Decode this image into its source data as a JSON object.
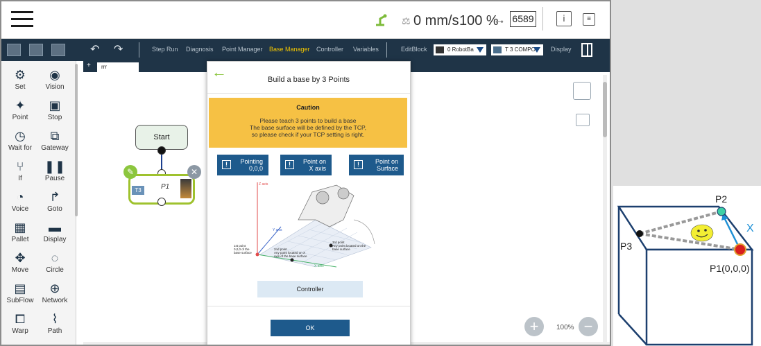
{
  "status": {
    "speed": "0 mm/s",
    "percent": "100 %",
    "counter": "6589",
    "info_icon": "info-icon",
    "menu_icon": "menu-icon"
  },
  "toolbar": {
    "items": [
      "Step Run",
      "Diagnosis",
      "Point Manager",
      "Base Manager",
      "Controller",
      "Variables",
      "EditBlock",
      "Display"
    ],
    "robot_drop": "0 RobotBa",
    "compo_drop": "T 3 COMPO"
  },
  "palette": [
    {
      "label": "Set",
      "icon": "set-icon"
    },
    {
      "label": "Vision",
      "icon": "vision-icon"
    },
    {
      "label": "Point",
      "icon": "point-icon"
    },
    {
      "label": "Stop",
      "icon": "stop-icon"
    },
    {
      "label": "Wait for",
      "icon": "wait-icon"
    },
    {
      "label": "Gateway",
      "icon": "gateway-icon"
    },
    {
      "label": "If",
      "icon": "if-icon"
    },
    {
      "label": "Pause",
      "icon": "pause-icon"
    },
    {
      "label": "Voice",
      "icon": "voice-icon"
    },
    {
      "label": "Goto",
      "icon": "goto-icon"
    },
    {
      "label": "Pallet",
      "icon": "pallet-icon"
    },
    {
      "label": "Display",
      "icon": "display-icon"
    },
    {
      "label": "Move",
      "icon": "move-icon"
    },
    {
      "label": "Circle",
      "icon": "circle-icon"
    },
    {
      "label": "SubFlow",
      "icon": "subflow-icon"
    },
    {
      "label": "Network",
      "icon": "network-icon"
    },
    {
      "label": "Warp",
      "icon": "warp-icon"
    },
    {
      "label": "Path",
      "icon": "path-icon"
    }
  ],
  "canvas": {
    "tab_label": "rrr",
    "start_label": "Start",
    "p1_label": "P1",
    "p1_tag": "T3",
    "zoom": "100%"
  },
  "modal": {
    "title": "Build a base by 3 Points",
    "caution_title": "Caution",
    "caution_line1": "Please teach 3 points to build a base",
    "caution_line2": "The base surface will be defined by the TCP,",
    "caution_line3": "so please check if your TCP setting is right.",
    "btn_pointing_1": "Pointing",
    "btn_pointing_2": "0,0,0",
    "btn_xaxis_1": "Point on",
    "btn_xaxis_2": "X axis",
    "btn_surface_1": "Point on",
    "btn_surface_2": "Surface",
    "diagram": {
      "z_axis": "Z axis",
      "y_axis": "Y axis",
      "x_axis": "X axis",
      "pt1_a": "1st point",
      "pt1_b": "0,0,0 of the",
      "pt1_c": "base surface",
      "pt2_a": "2nd point",
      "pt2_b": "Any point located on X",
      "pt2_c": "axis of the base surface",
      "pt3_a": "3rd point",
      "pt3_b": "Any point located on the",
      "pt3_c": "base surface"
    },
    "controller": "Controller",
    "ok": "OK"
  },
  "illustration": {
    "p1": "P1(0,0,0)",
    "p2": "P2",
    "p3": "P3",
    "x": "X"
  }
}
